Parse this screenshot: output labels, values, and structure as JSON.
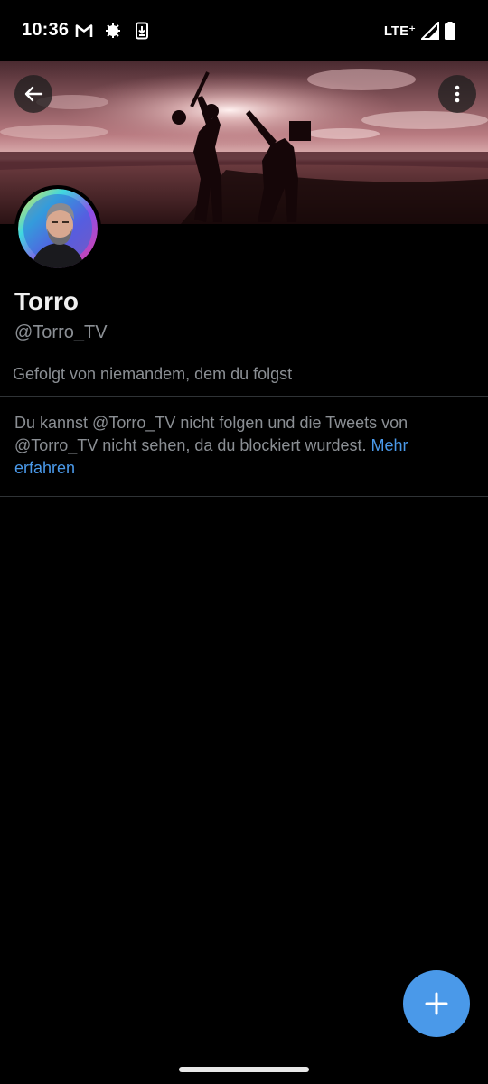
{
  "status_bar": {
    "time": "10:36",
    "network": "LTE⁺",
    "left_icons": [
      "gmail-icon",
      "notification-app-icon",
      "download-icon"
    ],
    "right_icons": [
      "signal-icon",
      "battery-icon"
    ]
  },
  "header": {
    "back_icon": "arrow-left-icon",
    "more_icon": "more-vertical-icon"
  },
  "profile": {
    "name": "Torro",
    "handle": "@Torro_TV",
    "followed_by": "Gefolgt von niemandem, dem du folgst"
  },
  "blocked_notice": {
    "text": "Du kannst @Torro_TV nicht folgen und die Tweets von @Torro_TV nicht sehen, da du blockiert wurdest. ",
    "link_text": "Mehr erfahren"
  },
  "fab": {
    "icon": "plus-icon"
  },
  "colors": {
    "background": "#000000",
    "accent": "#4a99e9",
    "secondary_text": "#8b8f94",
    "divider": "#2f3336"
  }
}
